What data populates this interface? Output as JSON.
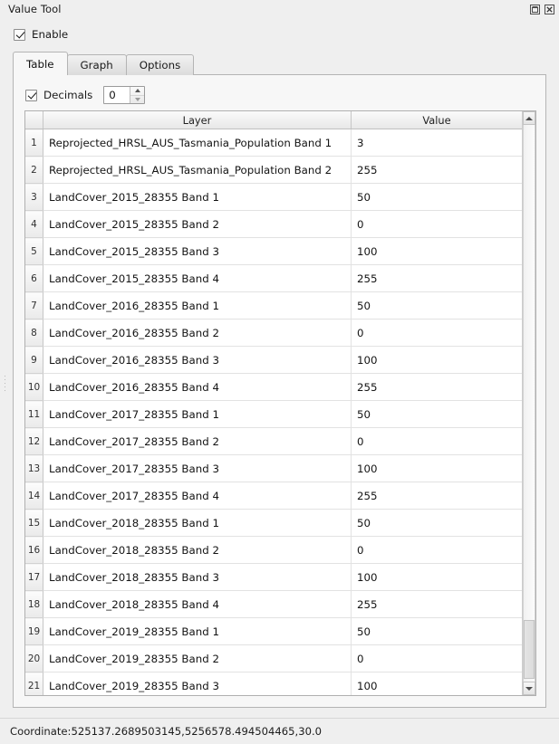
{
  "window": {
    "title": "Value Tool",
    "buttons": [
      {
        "name": "float-icon",
        "label": "⧉"
      },
      {
        "name": "close-icon",
        "label": "⌧"
      }
    ]
  },
  "enable": {
    "label": "Enable",
    "checked": true
  },
  "tabs": [
    {
      "label": "Table",
      "active": true
    },
    {
      "label": "Graph",
      "active": false
    },
    {
      "label": "Options",
      "active": false
    }
  ],
  "decimals": {
    "label": "Decimals",
    "checked": true,
    "value": "0"
  },
  "table": {
    "columns": [
      "Layer",
      "Value"
    ],
    "rows": [
      {
        "n": "1",
        "layer": "Reprojected_HRSL_AUS_Tasmania_Population Band 1",
        "value": "3"
      },
      {
        "n": "2",
        "layer": "Reprojected_HRSL_AUS_Tasmania_Population Band 2",
        "value": "255"
      },
      {
        "n": "3",
        "layer": "LandCover_2015_28355 Band 1",
        "value": "50"
      },
      {
        "n": "4",
        "layer": "LandCover_2015_28355 Band 2",
        "value": "0"
      },
      {
        "n": "5",
        "layer": "LandCover_2015_28355 Band 3",
        "value": "100"
      },
      {
        "n": "6",
        "layer": "LandCover_2015_28355 Band 4",
        "value": "255"
      },
      {
        "n": "7",
        "layer": "LandCover_2016_28355 Band 1",
        "value": "50"
      },
      {
        "n": "8",
        "layer": "LandCover_2016_28355 Band 2",
        "value": "0"
      },
      {
        "n": "9",
        "layer": "LandCover_2016_28355 Band 3",
        "value": "100"
      },
      {
        "n": "10",
        "layer": "LandCover_2016_28355 Band 4",
        "value": "255"
      },
      {
        "n": "11",
        "layer": "LandCover_2017_28355 Band 1",
        "value": "50"
      },
      {
        "n": "12",
        "layer": "LandCover_2017_28355 Band 2",
        "value": "0"
      },
      {
        "n": "13",
        "layer": "LandCover_2017_28355 Band 3",
        "value": "100"
      },
      {
        "n": "14",
        "layer": "LandCover_2017_28355 Band 4",
        "value": "255"
      },
      {
        "n": "15",
        "layer": "LandCover_2018_28355 Band 1",
        "value": "50"
      },
      {
        "n": "16",
        "layer": "LandCover_2018_28355 Band 2",
        "value": "0"
      },
      {
        "n": "17",
        "layer": "LandCover_2018_28355 Band 3",
        "value": "100"
      },
      {
        "n": "18",
        "layer": "LandCover_2018_28355 Band 4",
        "value": "255"
      },
      {
        "n": "19",
        "layer": "LandCover_2019_28355 Band 1",
        "value": "50"
      },
      {
        "n": "20",
        "layer": "LandCover_2019_28355 Band 2",
        "value": "0"
      },
      {
        "n": "21",
        "layer": "LandCover_2019_28355 Band 3",
        "value": "100"
      }
    ],
    "partial_row": {
      "n": "",
      "layer": "",
      "value": ""
    }
  },
  "statusbar": {
    "coordinate": "Coordinate:525137.2689503145,5256578.494504465,30.0"
  },
  "colors": {
    "window_bg": "#efefef",
    "panel_bg": "#f7f7f7",
    "table_bg": "#ffffff",
    "border": "#b4b4b4",
    "text": "#1a1a1a"
  }
}
